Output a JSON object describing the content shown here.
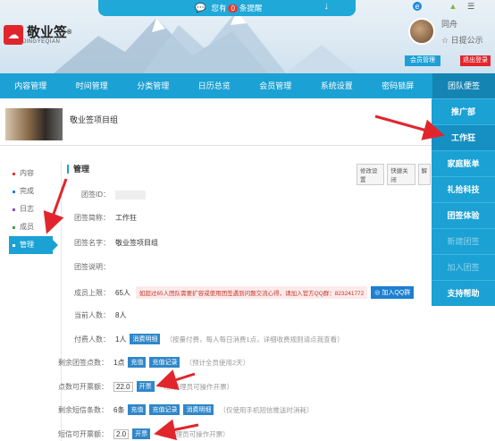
{
  "notice": {
    "prefix": "您有",
    "count": "0",
    "suffix": "条提醒"
  },
  "logo": {
    "name": "敬业签",
    "sub": "JINGYEQIAN",
    "reg": "®"
  },
  "user": {
    "name": "同舟",
    "status": "日提公示"
  },
  "header_buttons": {
    "member": "会员管理",
    "logout": "退出登录"
  },
  "nav": [
    "内容管理",
    "时间管理",
    "分类管理",
    "日历总览",
    "会员管理",
    "系统设置",
    "密码锁屏",
    "团队便签"
  ],
  "dropdown": [
    {
      "label": "推广部",
      "state": "normal"
    },
    {
      "label": "工作狂",
      "state": "highlight"
    },
    {
      "label": "家庭账单",
      "state": "normal"
    },
    {
      "label": "礼拾科技",
      "state": "normal"
    },
    {
      "label": "团签体验",
      "state": "normal"
    },
    {
      "label": "新建团签",
      "state": "dim"
    },
    {
      "label": "加入团签",
      "state": "dim"
    },
    {
      "label": "支持帮助",
      "state": "normal"
    }
  ],
  "group": {
    "title": "敬业签项目组"
  },
  "sidebar": [
    {
      "label": "内容",
      "color": "#e53935"
    },
    {
      "label": "完成",
      "color": "#1e88e5"
    },
    {
      "label": "日志",
      "color": "#7e57c2"
    },
    {
      "label": "成员",
      "color": "#43a047"
    },
    {
      "label": "管理",
      "color": "#ffffff"
    }
  ],
  "panel": {
    "title": "管理",
    "tools": [
      "修改设置",
      "快捷关闭",
      "解"
    ],
    "rows": {
      "id_label": "团签ID：",
      "short_label": "团签简称：",
      "short_val": "工作狂",
      "full_label": "团签名字：",
      "full_val": "敬业签项目组",
      "desc_label": "团签说明：",
      "limit_label": "成员上限：",
      "limit_val": "65人",
      "limit_warn": "如超过65人团队需要扩容或使用团签遇到问题交流心得，请加入官方QQ群：823241772",
      "qq_btn": "加入QQ群",
      "current_label": "当前人数：",
      "current_val": "8人",
      "paid_label": "付费人数：",
      "paid_val": "1人",
      "paid_btn": "消费明细",
      "paid_hint": "（按量付费，每人每日消费1点，详细收费规则请点我查看）",
      "points_label": "剩余团签点数：",
      "points_val": "1点",
      "points_btn1": "充值",
      "points_btn2": "充值记录",
      "points_hint": "（预计全员使用2天）",
      "invoice_label": "点数可开票额：",
      "invoice_val": "22.0",
      "invoice_btn": "开票",
      "invoice_hint": "（仅管理员可操作开票）",
      "sms_label": "剩余短信条数：",
      "sms_val": "6条",
      "sms_btn1": "充值",
      "sms_btn2": "充值记录",
      "sms_btn3": "消费明细",
      "sms_hint": "（仅使用手机短信推送时消耗）",
      "sms_invoice_label": "短信可开票额：",
      "sms_invoice_val": "2.0",
      "sms_invoice_btn": "开票",
      "sms_invoice_hint": "（仅管理员可操作开票）"
    }
  }
}
